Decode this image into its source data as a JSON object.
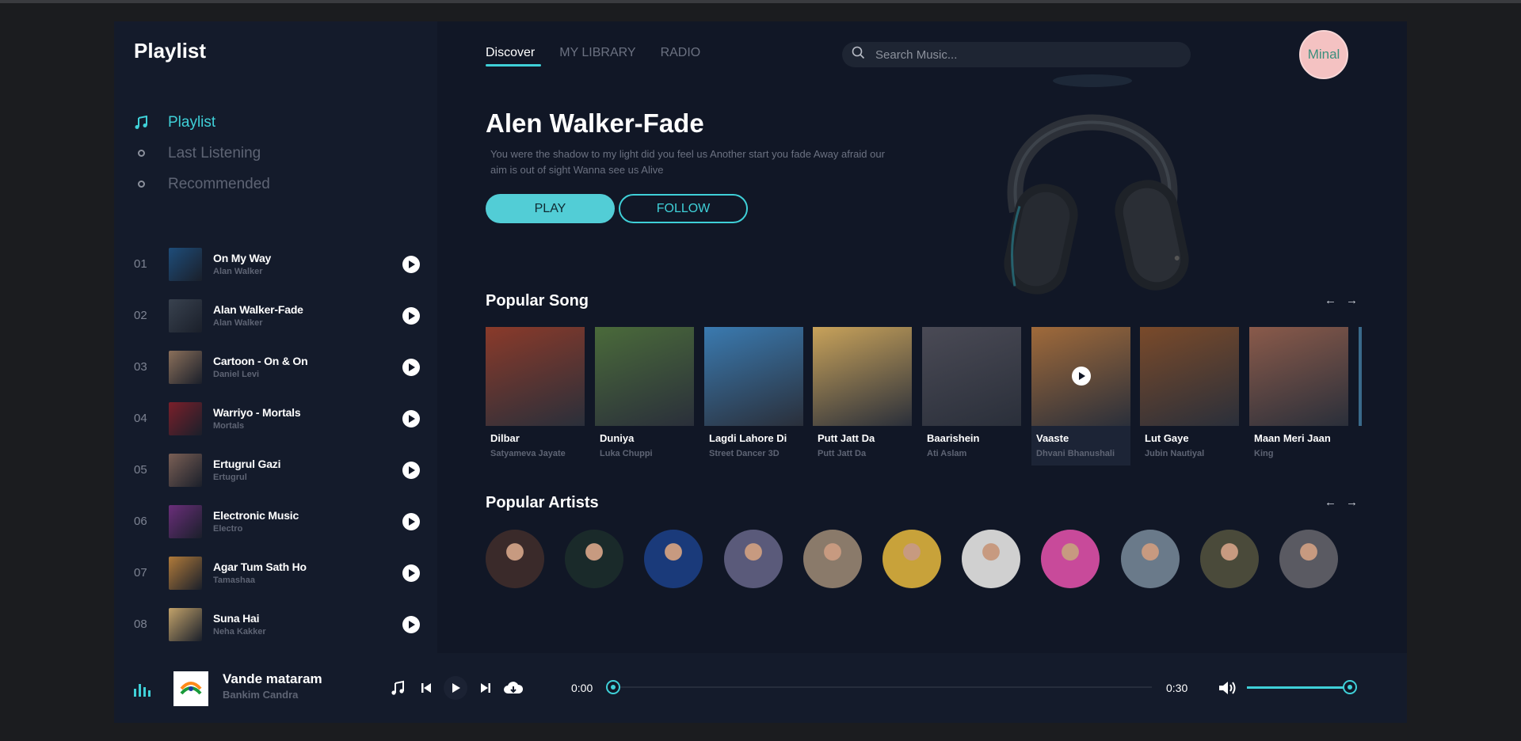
{
  "sidebar": {
    "title": "Playlist",
    "nav": [
      {
        "label": "Playlist",
        "active": true
      },
      {
        "label": "Last Listening",
        "active": false
      },
      {
        "label": "Recommended",
        "active": false
      }
    ],
    "tracks": [
      {
        "num": "01",
        "title": "On My Way",
        "artist": "Alan Walker",
        "color": "#1e4d7a"
      },
      {
        "num": "02",
        "title": "Alan Walker-Fade",
        "artist": "Alan Walker",
        "color": "#39424f"
      },
      {
        "num": "03",
        "title": "Cartoon - On & On",
        "artist": "Daniel Levi",
        "color": "#8a6f5a"
      },
      {
        "num": "04",
        "title": "Warriyo - Mortals",
        "artist": "Mortals",
        "color": "#7a1f2a"
      },
      {
        "num": "05",
        "title": "Ertugrul Gazi",
        "artist": "Ertugrul",
        "color": "#7a5f55"
      },
      {
        "num": "06",
        "title": "Electronic Music",
        "artist": "Electro",
        "color": "#6a2e7a"
      },
      {
        "num": "07",
        "title": "Agar Tum Sath Ho",
        "artist": "Tamashaa",
        "color": "#b07a3a"
      },
      {
        "num": "08",
        "title": "Suna Hai",
        "artist": "Neha Kakker",
        "color": "#c2a26a"
      }
    ]
  },
  "header": {
    "tabs": [
      {
        "label": "Discover",
        "active": true
      },
      {
        "label": "MY LIBRARY",
        "active": false
      },
      {
        "label": "RADIO",
        "active": false
      }
    ],
    "search_placeholder": "Search Music...",
    "user": "Minal"
  },
  "hero": {
    "title": "Alen Walker-Fade",
    "description": "You were the shadow to my light did you feel us Another start you fade Away afraid our aim is out of sight Wanna see us Alive",
    "play_label": "PLAY",
    "follow_label": "FOLLOW"
  },
  "popular_songs": {
    "title": "Popular Song",
    "items": [
      {
        "title": "Dilbar",
        "artist": "Satyameva Jayate",
        "color": "#8a3a2a"
      },
      {
        "title": "Duniya",
        "artist": "Luka Chuppi",
        "color": "#4a6a3a"
      },
      {
        "title": "Lagdi Lahore Di",
        "artist": "Street Dancer 3D",
        "color": "#3a7ab0"
      },
      {
        "title": "Putt Jatt Da",
        "artist": "Putt Jatt Da",
        "color": "#c8a25a"
      },
      {
        "title": "Baarishein",
        "artist": "Ati Aslam",
        "color": "#4a4a55"
      },
      {
        "title": "Vaaste",
        "artist": "Dhvani Bhanushali",
        "color": "#a06a3a"
      },
      {
        "title": "Lut Gaye",
        "artist": "Jubin Nautiyal",
        "color": "#7a4a2a"
      },
      {
        "title": "Maan Meri Jaan",
        "artist": "King",
        "color": "#8a5a4a"
      }
    ]
  },
  "popular_artists": {
    "title": "Popular Artists",
    "colors": [
      "#3a2a2a",
      "#1a2a2a",
      "#1a3a7a",
      "#5a5a7a",
      "#8a7a6a",
      "#c8a23a",
      "#d0d0d0",
      "#c84a9a",
      "#6a7a8a",
      "#4a4a3a",
      "#5a5a62"
    ]
  },
  "player": {
    "title": "Vande mataram",
    "artist": "Bankim Candra",
    "time_current": "0:00",
    "time_total": "0:30",
    "progress": 0,
    "volume": 1.0
  },
  "colors": {
    "accent": "#3fd0d8",
    "background": "#111726",
    "panel": "#141b2b"
  }
}
